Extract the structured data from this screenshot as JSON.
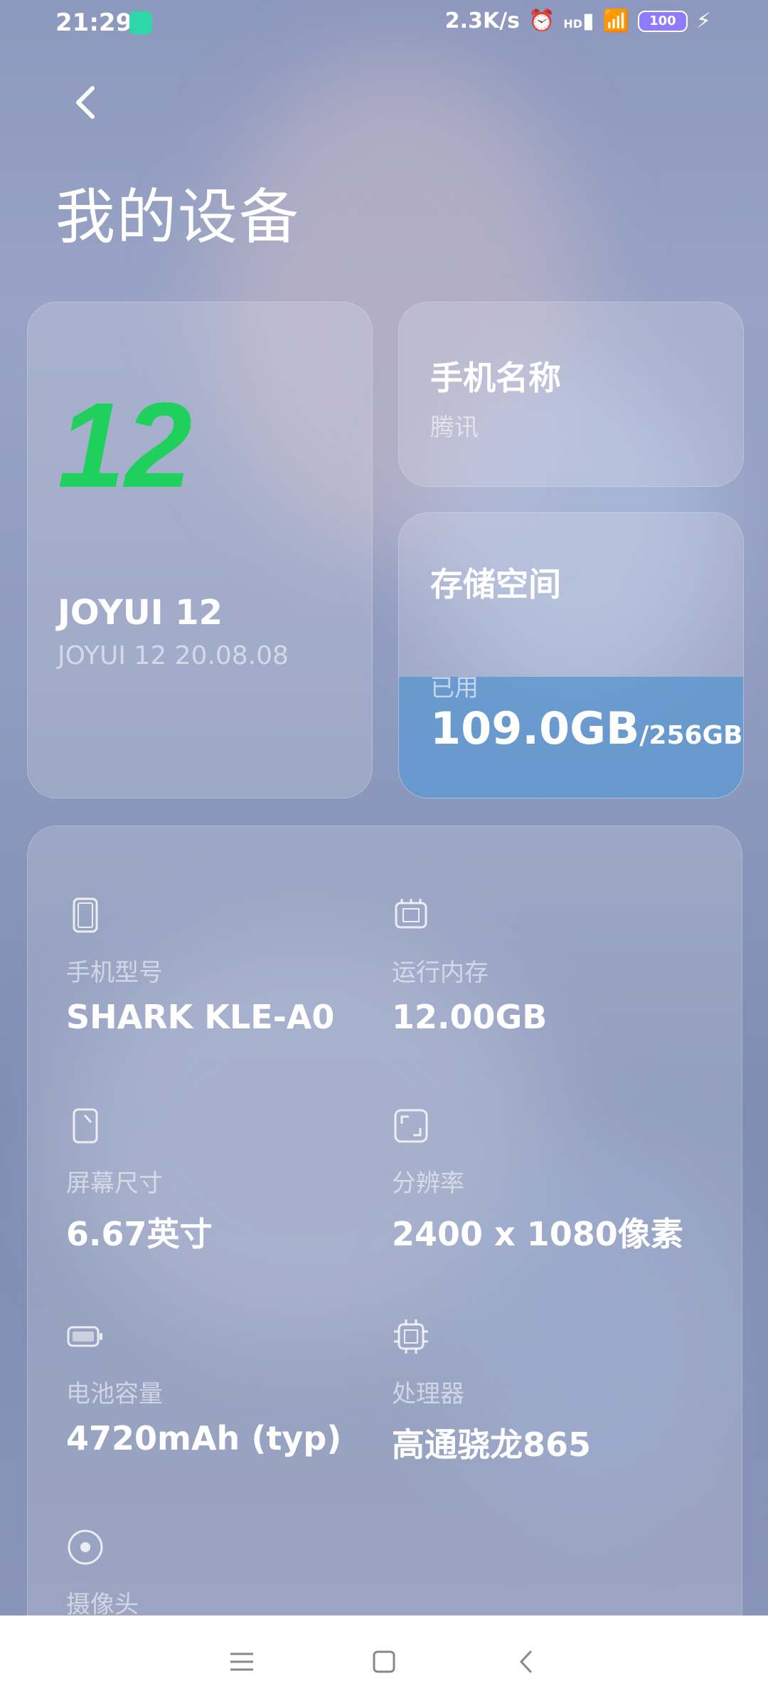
{
  "status_bar": {
    "time": "21:29",
    "net_speed": "2.3K/s",
    "signal_label": "HD",
    "battery": "100"
  },
  "header": {
    "back_icon": "chevron-left-icon",
    "title": "我的设备"
  },
  "os_card": {
    "logo_text": "12",
    "logo_color": "#1fd15c",
    "name": "JOYUI 12",
    "version": "JOYUI 12 20.08.08"
  },
  "phone_name_card": {
    "label": "手机名称",
    "value": "腾讯"
  },
  "storage_card": {
    "label": "存储空间",
    "used_label": "已用",
    "used_value": "109.0GB",
    "total_value": "/256GB",
    "used_fraction": 0.426
  },
  "specs": [
    {
      "icon": "phone-icon",
      "label": "手机型号",
      "value": "SHARK KLE-A0"
    },
    {
      "icon": "memory-chip-icon",
      "label": "运行内存",
      "value": "12.00GB"
    },
    {
      "icon": "screen-size-icon",
      "label": "屏幕尺寸",
      "value": "6.67英寸"
    },
    {
      "icon": "resolution-icon",
      "label": "分辨率",
      "value": "2400 x 1080像素"
    },
    {
      "icon": "battery-icon",
      "label": "电池容量",
      "value": "4720mAh (typ)"
    },
    {
      "icon": "processor-icon",
      "label": "处理器",
      "value": "高通骁龙865"
    },
    {
      "icon": "camera-icon",
      "label": "摄像头",
      "value": ""
    }
  ],
  "nav_bar": {
    "menu_icon": "menu-icon",
    "home_icon": "home-icon",
    "back_icon": "back-icon"
  }
}
